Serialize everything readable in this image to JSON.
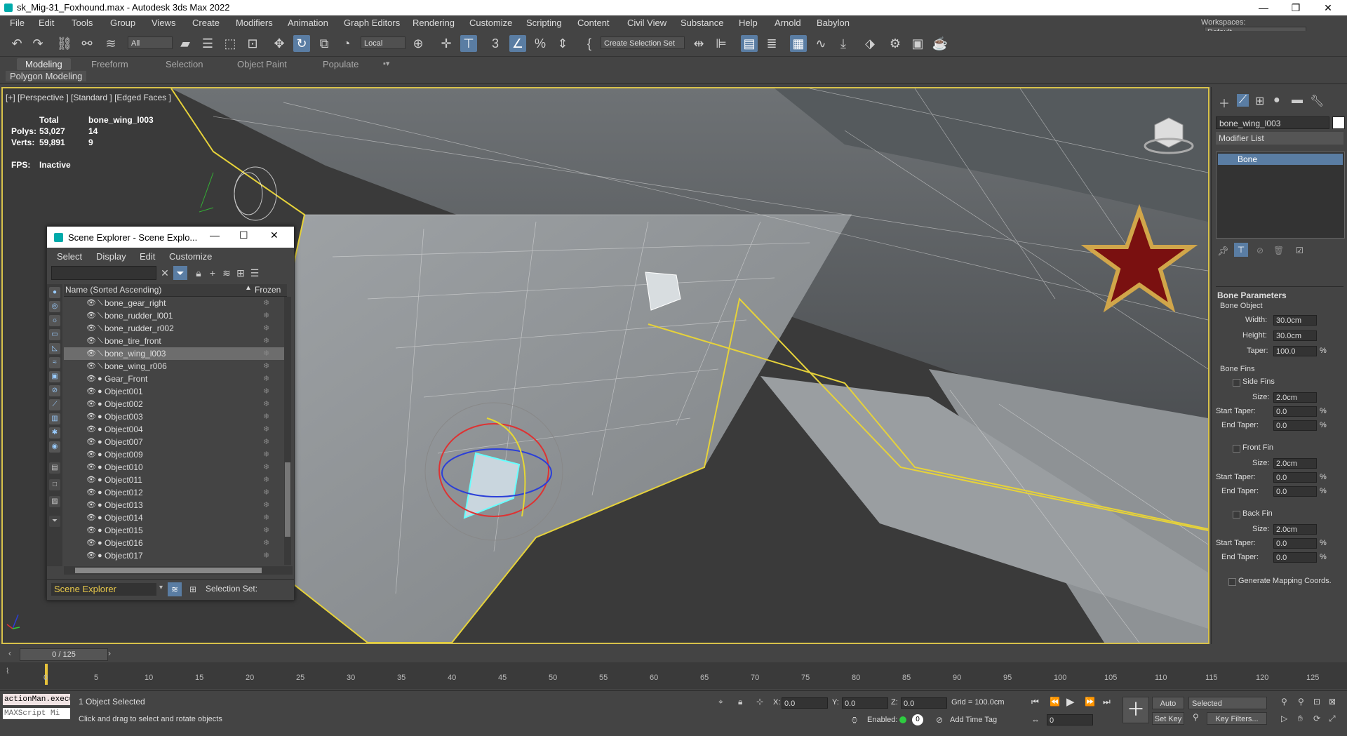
{
  "window": {
    "title": "sk_Mig-31_Foxhound.max - Autodesk 3ds Max 2022"
  },
  "menu": [
    "File",
    "Edit",
    "Tools",
    "Group",
    "Views",
    "Create",
    "Modifiers",
    "Animation",
    "Graph Editors",
    "Rendering",
    "Customize",
    "Scripting",
    "Content",
    "Civil View",
    "Substance",
    "Help",
    "Arnold",
    "Babylon"
  ],
  "workspace": {
    "label": "Workspaces:",
    "value": "Default"
  },
  "toolbar": {
    "filter": "All",
    "coord": "Local",
    "selection_set": "Create Selection Set"
  },
  "ribbon": {
    "tabs": [
      "Modeling",
      "Freeform",
      "Selection",
      "Object Paint",
      "Populate"
    ],
    "sub": "Polygon Modeling"
  },
  "viewport": {
    "label": "[+] [Perspective ] [Standard ] [Edged Faces ]",
    "stats": {
      "total": "Total",
      "object": "bone_wing_l003",
      "polys_label": "Polys:",
      "polys_total": "53,027",
      "polys_obj": "14",
      "verts_label": "Verts:",
      "verts_total": "59,891",
      "verts_obj": "9",
      "fps_label": "FPS:",
      "fps_value": "Inactive"
    }
  },
  "scene_explorer": {
    "title": "Scene Explorer - Scene Explo...",
    "menu": [
      "Select",
      "Display",
      "Edit",
      "Customize"
    ],
    "col_name": "Name (Sorted Ascending)",
    "col_frozen": "Frozen",
    "rows": [
      {
        "name": "bone_gear_right",
        "type": "bone"
      },
      {
        "name": "bone_rudder_l001",
        "type": "bone"
      },
      {
        "name": "bone_rudder_r002",
        "type": "bone"
      },
      {
        "name": "bone_tire_front",
        "type": "bone"
      },
      {
        "name": "bone_wing_l003",
        "type": "bone",
        "selected": true
      },
      {
        "name": "bone_wing_r006",
        "type": "bone"
      },
      {
        "name": "Gear_Front",
        "type": "mesh"
      },
      {
        "name": "Object001",
        "type": "mesh"
      },
      {
        "name": "Object002",
        "type": "mesh"
      },
      {
        "name": "Object003",
        "type": "mesh"
      },
      {
        "name": "Object004",
        "type": "mesh"
      },
      {
        "name": "Object007",
        "type": "mesh"
      },
      {
        "name": "Object009",
        "type": "mesh"
      },
      {
        "name": "Object010",
        "type": "mesh"
      },
      {
        "name": "Object011",
        "type": "mesh"
      },
      {
        "name": "Object012",
        "type": "mesh"
      },
      {
        "name": "Object013",
        "type": "mesh"
      },
      {
        "name": "Object014",
        "type": "mesh"
      },
      {
        "name": "Object015",
        "type": "mesh"
      },
      {
        "name": "Object016",
        "type": "mesh"
      },
      {
        "name": "Object017",
        "type": "mesh"
      }
    ],
    "footer_dropdown": "Scene Explorer",
    "footer_label": "Selection Set:"
  },
  "command_panel": {
    "object_name": "bone_wing_l003",
    "modifier_list": "Modifier List",
    "stack": [
      "Bone"
    ],
    "bone_parameters": "Bone Parameters",
    "bone_object": "Bone Object",
    "width_label": "Width:",
    "width": "30.0cm",
    "height_label": "Height:",
    "height": "30.0cm",
    "taper_label": "Taper:",
    "taper": "100.0",
    "bone_fins": "Bone Fins",
    "side_fins": "Side Fins",
    "front_fin": "Front Fin",
    "back_fin": "Back Fin",
    "size_label": "Size:",
    "size": "2.0cm",
    "start_taper_label": "Start Taper:",
    "end_taper_label": "End Taper:",
    "taper_zero": "0.0",
    "pct": "%",
    "gen_mapping": "Generate Mapping Coords."
  },
  "timeline": {
    "slider": "0 / 125",
    "ticks": [
      0,
      5,
      10,
      15,
      20,
      25,
      30,
      35,
      40,
      45,
      50,
      55,
      60,
      65,
      70,
      75,
      80,
      85,
      90,
      95,
      100,
      105,
      110,
      115,
      120,
      125
    ]
  },
  "status": {
    "script1": "actionMan.execu",
    "script2": "MAXScript Mi",
    "selected": "1 Object Selected",
    "hint": "Click and drag to select and rotate objects",
    "x_label": "X:",
    "x": "0.0",
    "y_label": "Y:",
    "y": "0.0",
    "z_label": "Z:",
    "z": "0.0",
    "grid": "Grid = 100.0cm",
    "enabled": "Enabled:",
    "add_time_tag": "Add Time Tag",
    "auto_key": "Auto Key",
    "set_key": "Set Key",
    "key_mode": "Selected",
    "key_filters": "Key Filters...",
    "frame": "0"
  }
}
